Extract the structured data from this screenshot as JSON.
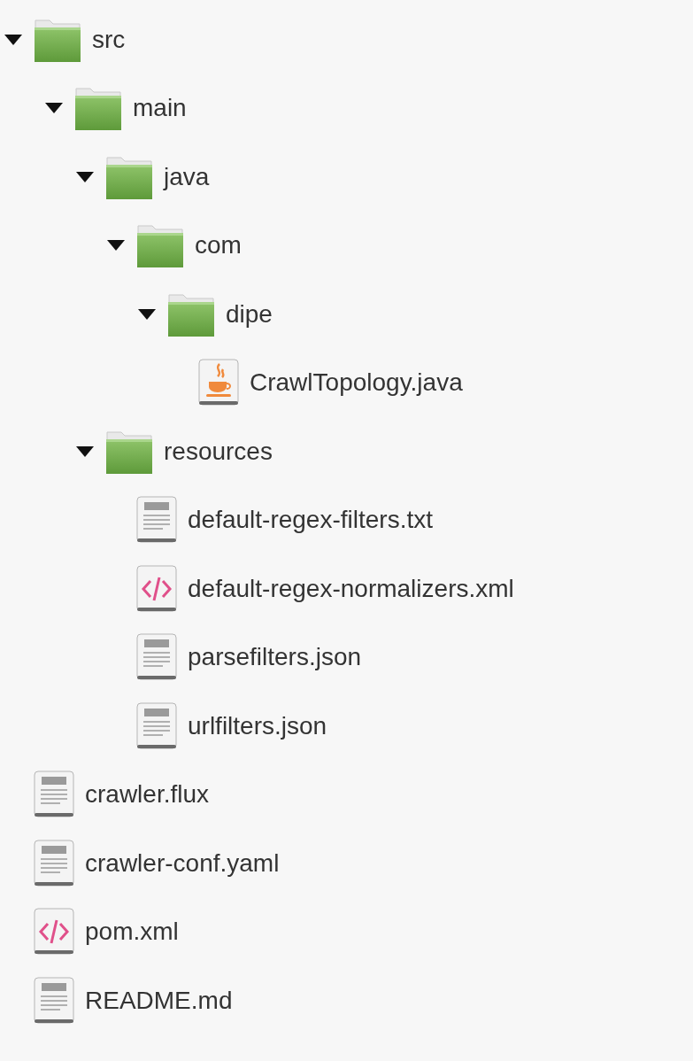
{
  "tree": [
    {
      "name": "src",
      "kind": "folder",
      "expanded": true,
      "children": [
        {
          "name": "main",
          "kind": "folder",
          "expanded": true,
          "children": [
            {
              "name": "java",
              "kind": "folder",
              "expanded": true,
              "children": [
                {
                  "name": "com",
                  "kind": "folder",
                  "expanded": true,
                  "children": [
                    {
                      "name": "dipe",
                      "kind": "folder",
                      "expanded": true,
                      "children": [
                        {
                          "name": "CrawlTopology.java",
                          "kind": "java"
                        }
                      ]
                    }
                  ]
                }
              ]
            },
            {
              "name": "resources",
              "kind": "folder",
              "expanded": true,
              "children": [
                {
                  "name": "default-regex-filters.txt",
                  "kind": "text"
                },
                {
                  "name": "default-regex-normalizers.xml",
                  "kind": "xml"
                },
                {
                  "name": "parsefilters.json",
                  "kind": "text"
                },
                {
                  "name": "urlfilters.json",
                  "kind": "text"
                }
              ]
            }
          ]
        }
      ]
    },
    {
      "name": "crawler.flux",
      "kind": "text"
    },
    {
      "name": "crawler-conf.yaml",
      "kind": "text"
    },
    {
      "name": "pom.xml",
      "kind": "xml"
    },
    {
      "name": "README.md",
      "kind": "text"
    }
  ]
}
